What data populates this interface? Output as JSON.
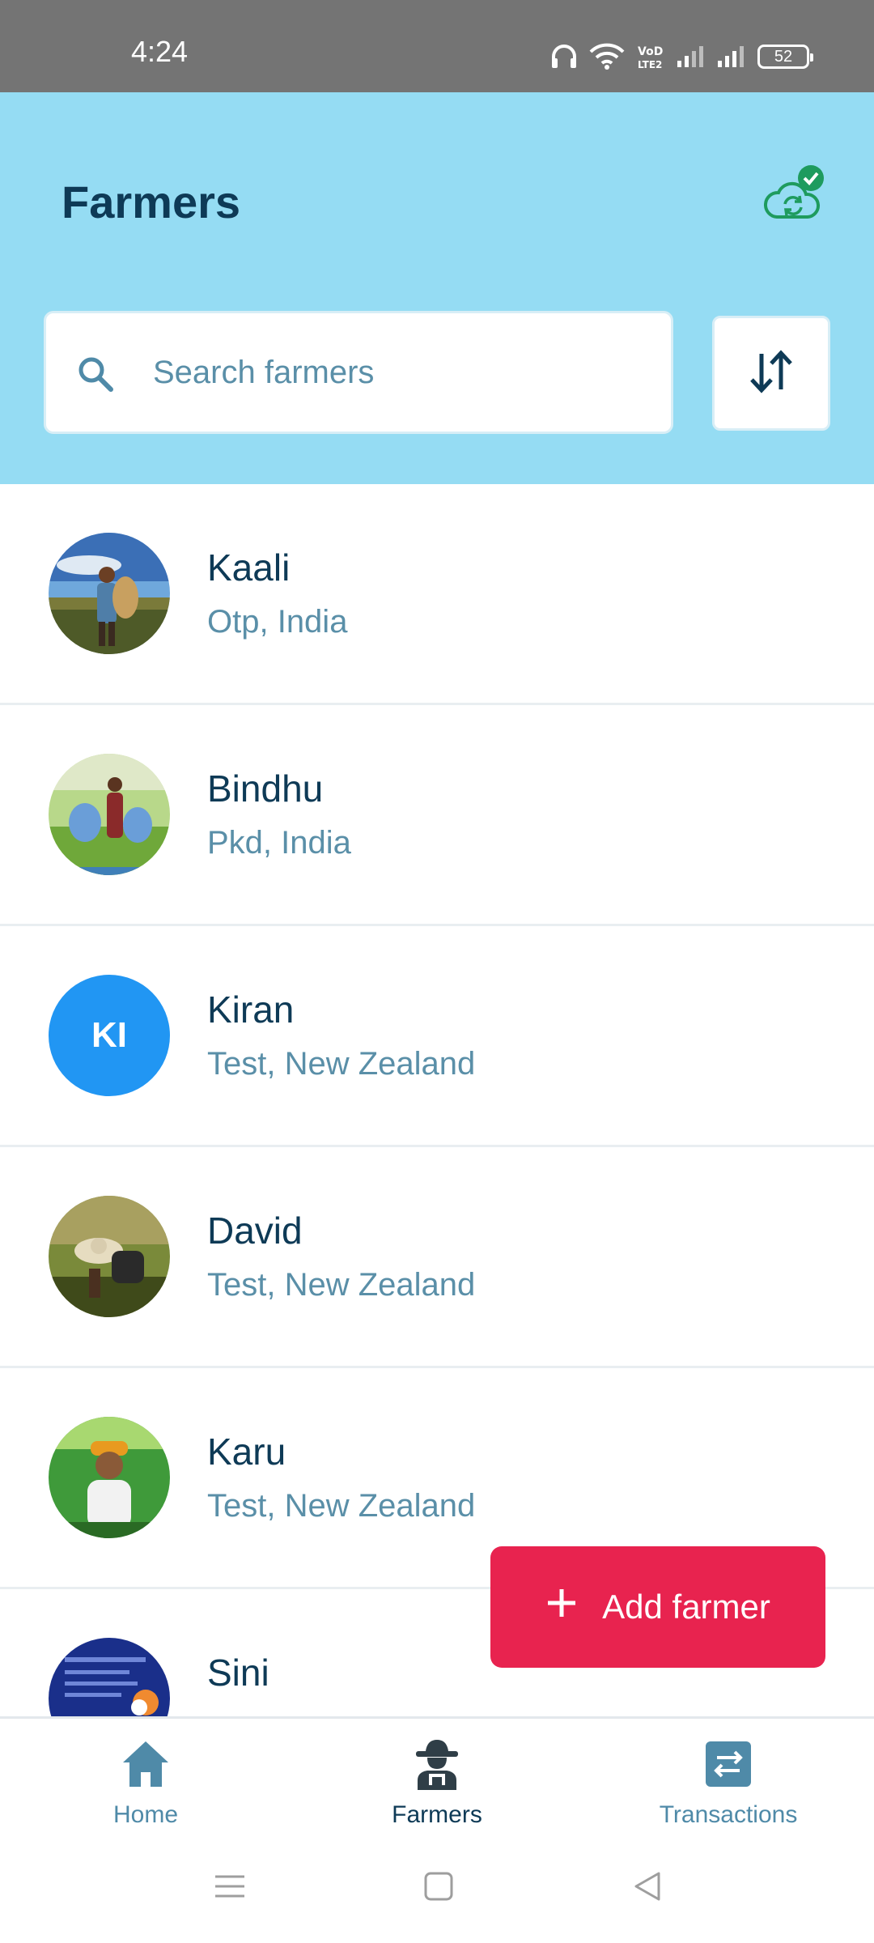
{
  "status_bar": {
    "time": "4:24",
    "battery": "52"
  },
  "header": {
    "title": "Farmers",
    "sync_icon": "cloud-sync-check-icon",
    "search_placeholder": "Search farmers",
    "sort_icon": "sort-arrows-icon",
    "background_color": "#95dcf3"
  },
  "farmers": [
    {
      "name": "Kaali",
      "location": "Otp, India",
      "avatar": "photo"
    },
    {
      "name": "Bindhu",
      "location": "Pkd, India",
      "avatar": "photo"
    },
    {
      "name": "Kiran",
      "location": "Test, New Zealand",
      "avatar": "initials",
      "initials": "KI"
    },
    {
      "name": "David",
      "location": "Test, New Zealand",
      "avatar": "photo"
    },
    {
      "name": "Karu",
      "location": "Test, New Zealand",
      "avatar": "photo"
    },
    {
      "name": "Sini",
      "location": "",
      "avatar": "photo"
    }
  ],
  "fab": {
    "label": "Add farmer",
    "icon": "plus-icon",
    "color": "#e8234f"
  },
  "bottom_nav": {
    "items": [
      {
        "label": "Home",
        "icon": "home-icon"
      },
      {
        "label": "Farmers",
        "icon": "farmer-icon",
        "active": true
      },
      {
        "label": "Transactions",
        "icon": "transactions-icon"
      }
    ]
  },
  "colors": {
    "primary_text": "#0e3a56",
    "secondary_text": "#5a8fa8",
    "accent_blue": "#2196f3"
  }
}
